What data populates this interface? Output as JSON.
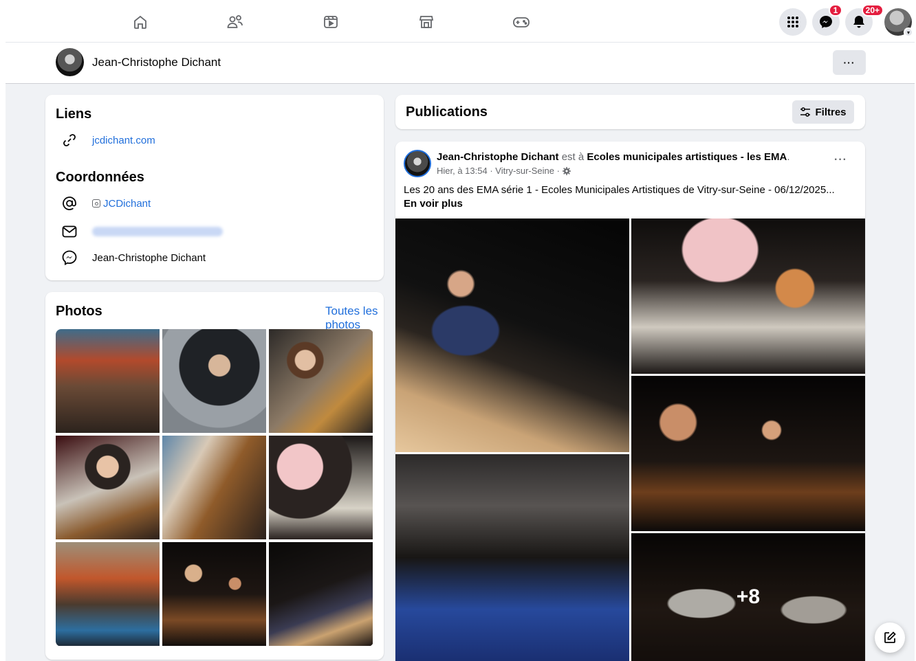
{
  "topnav": {
    "icons": [
      "home-icon",
      "friends-icon",
      "video-icon",
      "marketplace-icon",
      "gaming-icon"
    ],
    "menu_icon": "grid-menu-icon",
    "messenger_badge": "1",
    "notifications_badge": "20+"
  },
  "profilebar": {
    "name": "Jean-Christophe Dichant",
    "more_label": "···"
  },
  "links_card": {
    "title": "Liens",
    "website": "jcdichant.com",
    "contact_title": "Coordonnées",
    "instagram": "JCDichant",
    "messenger": "Jean-Christophe Dichant"
  },
  "photos_card": {
    "title": "Photos",
    "see_all": "Toutes les photos"
  },
  "publications": {
    "title": "Publications",
    "filter_label": "Filtres"
  },
  "post": {
    "author": "Jean-Christophe Dichant",
    "connector": " est à ",
    "place": "Ecoles municipales artistiques - les EMA",
    "period": ".",
    "meta": "Hier, à 13:54 · Vitry-sur-Seine ·",
    "text": "Les 20 ans des EMA série 1 - Ecoles Municipales Artistiques de Vitry-sur-Seine - 06/12/2025...",
    "see_more": "En voir plus",
    "more_label": "···",
    "extra_count": "+8"
  },
  "colors": {
    "accent": "#216fdb",
    "badge": "#e41e3f",
    "background": "#f0f2f5"
  }
}
